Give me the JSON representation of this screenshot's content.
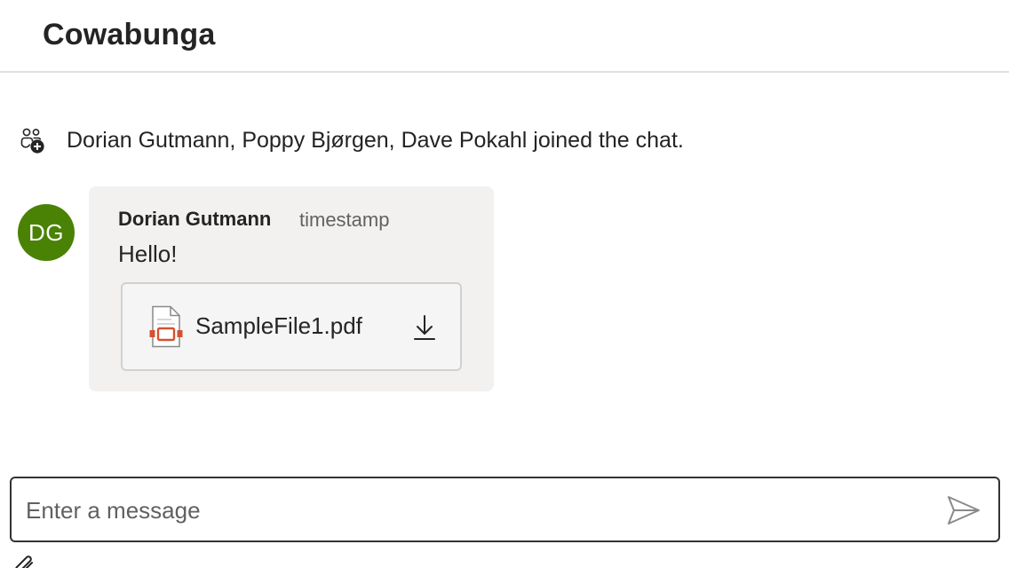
{
  "header": {
    "title": "Cowabunga"
  },
  "system_message": {
    "icon": "people-add-icon",
    "text": "Dorian Gutmann, Poppy Bjørgen, Dave Pokahl joined the chat."
  },
  "message": {
    "avatar_initials": "DG",
    "avatar_color": "#498205",
    "sender": "Dorian Gutmann",
    "timestamp": "timestamp",
    "text": "Hello!",
    "attachment": {
      "file_name": "SampleFile1.pdf",
      "file_icon": "pdf-file-icon",
      "action_icon": "download-icon"
    }
  },
  "composer": {
    "placeholder": "Enter a message",
    "value": "",
    "send_icon": "send-icon",
    "attach_icon": "paperclip-icon"
  }
}
